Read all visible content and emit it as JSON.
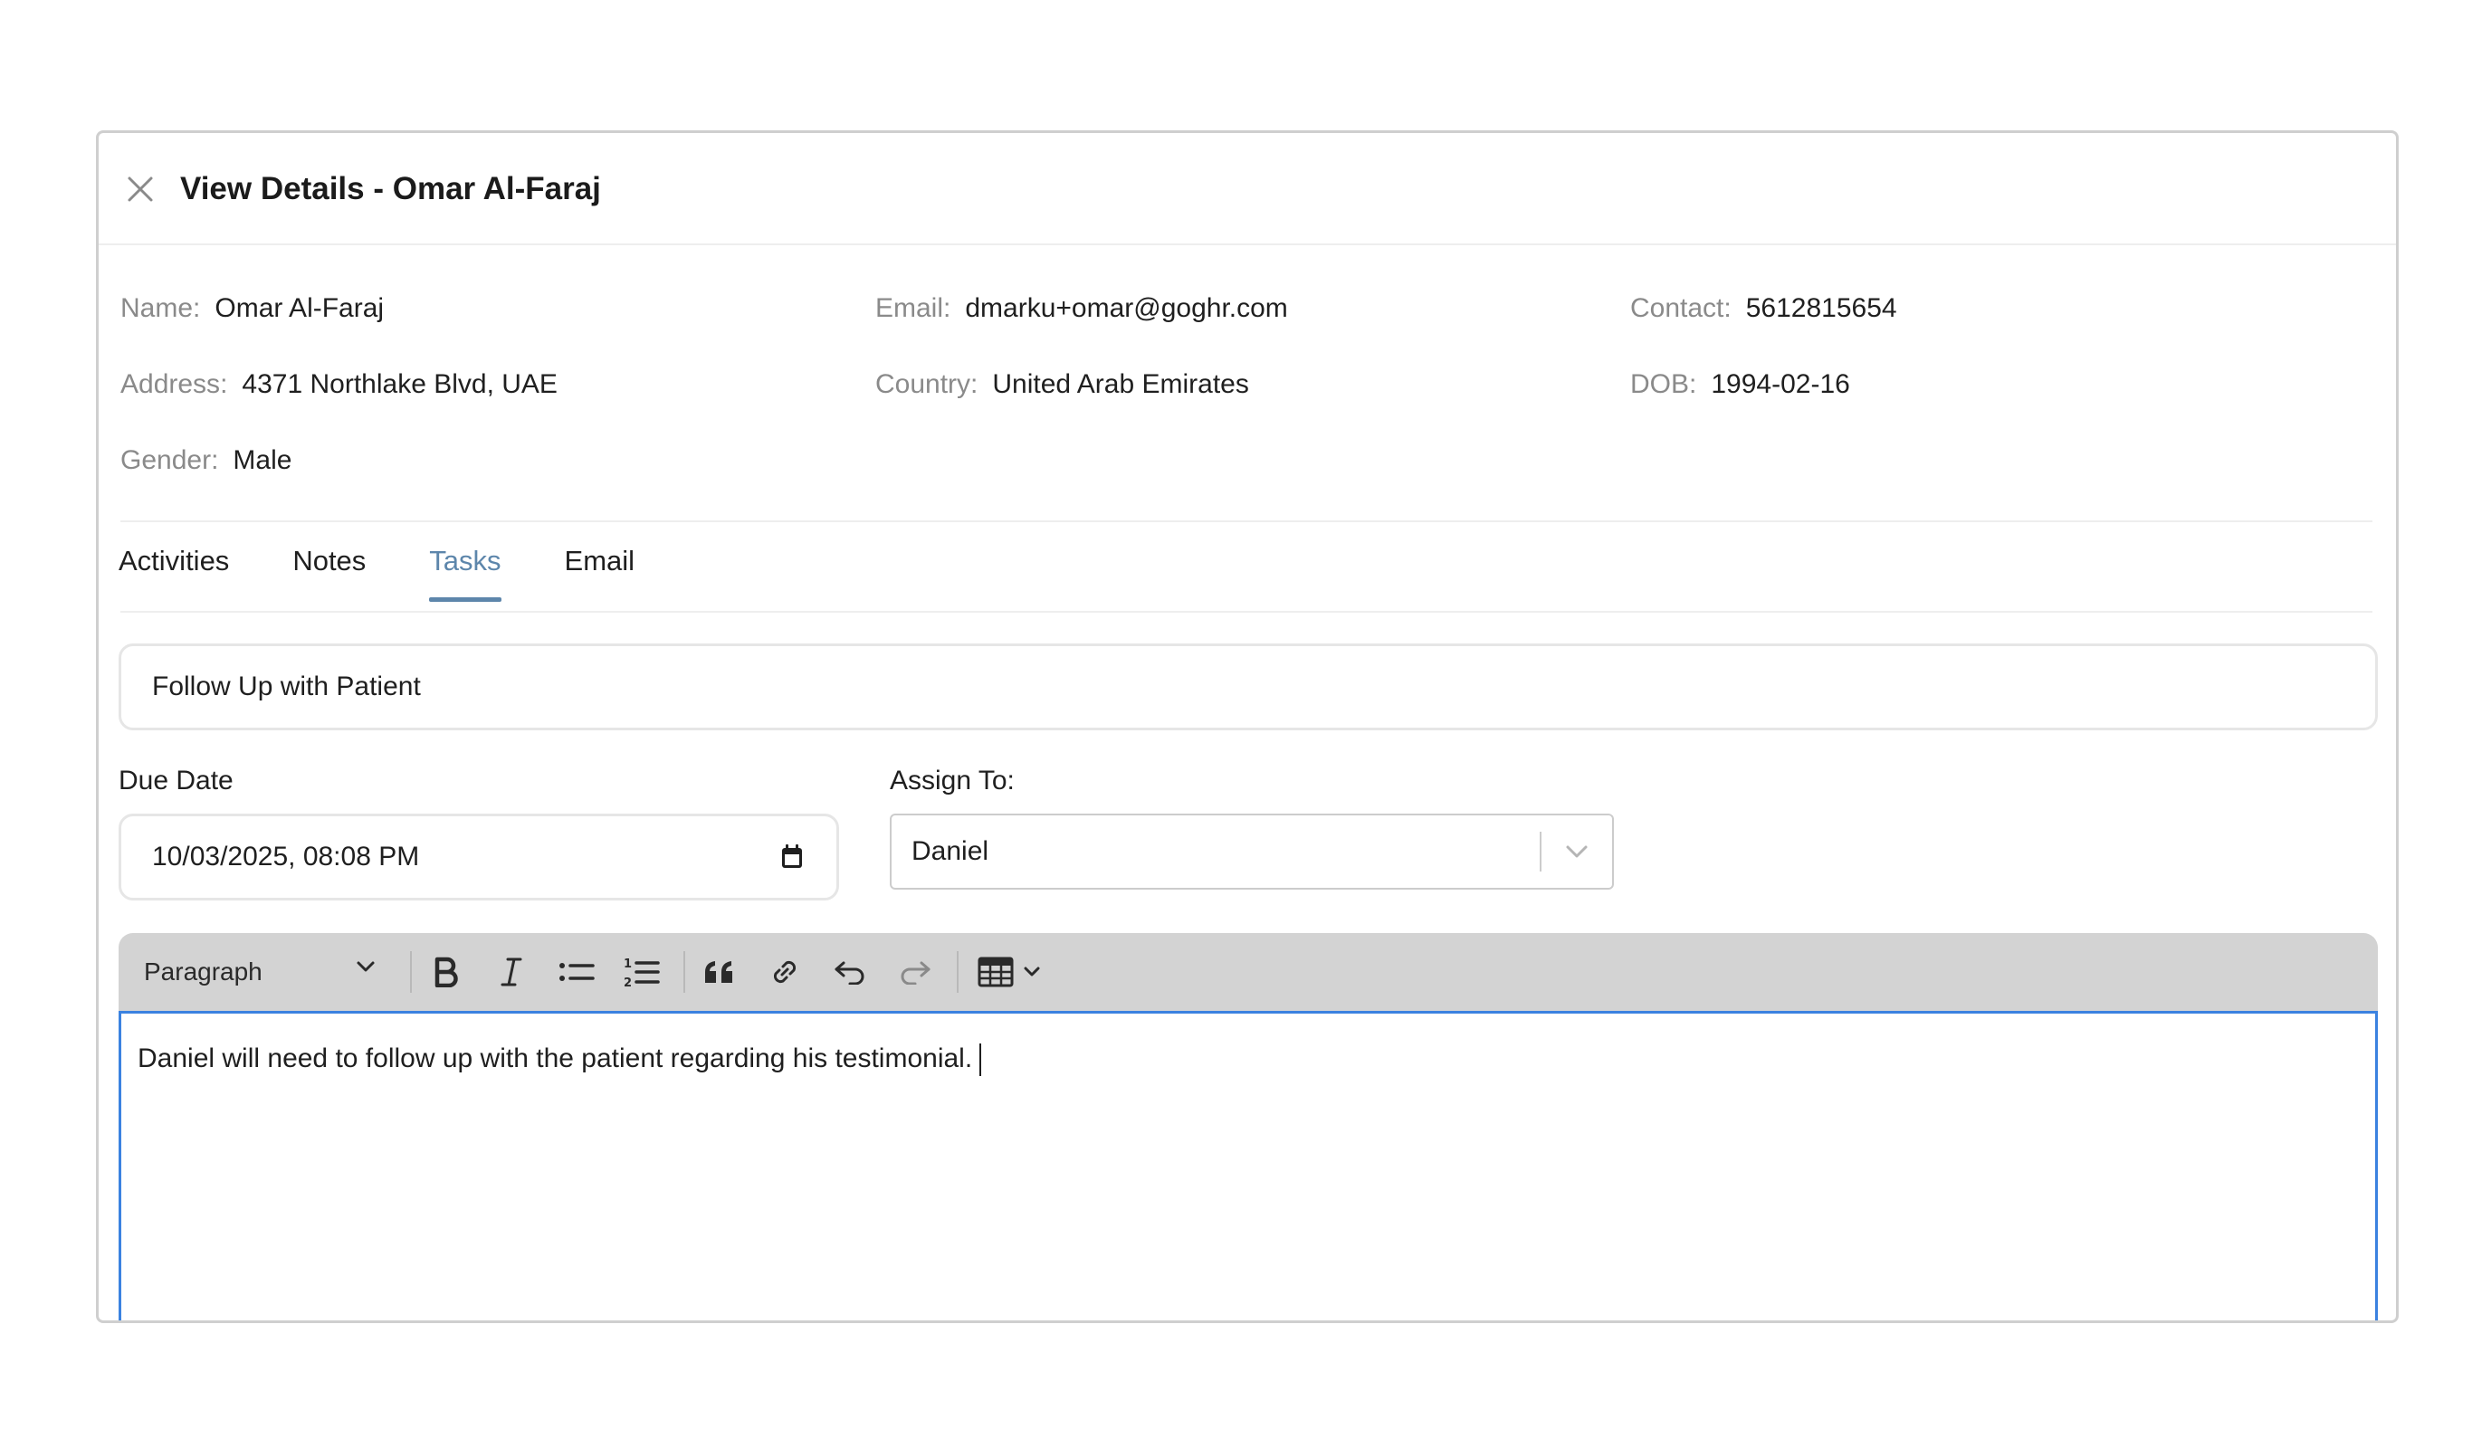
{
  "modal": {
    "title": "View Details - Omar Al-Faraj",
    "close_icon": "close-icon"
  },
  "details": {
    "name": {
      "label": "Name",
      "value": "Omar Al-Faraj"
    },
    "email": {
      "label": "Email",
      "value": "dmarku+omar@goghr.com"
    },
    "contact": {
      "label": "Contact",
      "value": "5612815654"
    },
    "address": {
      "label": "Address",
      "value": "4371 Northlake Blvd, UAE"
    },
    "country": {
      "label": "Country",
      "value": "United Arab Emirates"
    },
    "dob": {
      "label": "DOB",
      "value": "1994-02-16"
    },
    "gender": {
      "label": "Gender",
      "value": "Male"
    }
  },
  "tabs": [
    {
      "label": "Activities",
      "active": false
    },
    {
      "label": "Notes",
      "active": false
    },
    {
      "label": "Tasks",
      "active": true
    },
    {
      "label": "Email",
      "active": false
    }
  ],
  "task": {
    "title_value": "Follow Up with Patient",
    "due_date_label": "Due Date",
    "due_date_value": "10/03/2025, 08:08  PM",
    "assign_label": "Assign To:",
    "assign_value": "Daniel"
  },
  "editor": {
    "block_format": "Paragraph",
    "toolbar_icons": [
      "bold-icon",
      "italic-icon",
      "bulleted-list-icon",
      "numbered-list-icon",
      "block-quote-icon",
      "link-icon",
      "undo-icon",
      "redo-icon",
      "table-icon"
    ],
    "content": "Daniel will need to follow up with the patient regarding his testimonial."
  },
  "colors": {
    "active_tab": "#5d86ab",
    "toolbar_bg": "#d3d3d3",
    "editor_focus_border": "#3b82e0",
    "label_gray": "#8a8a8a"
  }
}
